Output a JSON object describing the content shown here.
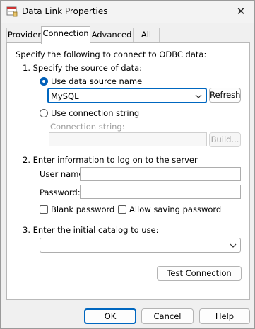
{
  "window": {
    "title": "Data Link Properties",
    "close_glyph": "✕",
    "icon": "datalink-icon"
  },
  "tabs": [
    {
      "label": "Provider"
    },
    {
      "label": "Connection"
    },
    {
      "label": "Advanced"
    },
    {
      "label": "All"
    }
  ],
  "connection": {
    "intro": "Specify the following to connect to ODBC data:",
    "step1": "1. Specify the source of data:",
    "radio_dsn": "Use data source name",
    "dsn_value": "MySQL",
    "refresh": "Refresh",
    "radio_connstr": "Use connection string",
    "connstr_label": "Connection string:",
    "connstr_value": "",
    "build": "Build...",
    "step2": "2. Enter information to log on to the server",
    "username_label": "User name:",
    "username_value": "",
    "password_label": "Password:",
    "password_value": "",
    "blank_password": "Blank password",
    "allow_saving": "Allow saving password",
    "step3": "3. Enter the initial catalog to use:",
    "catalog_value": "",
    "test_connection": "Test Connection"
  },
  "footer": {
    "ok": "OK",
    "cancel": "Cancel",
    "help": "Help"
  },
  "colors": {
    "accent": "#005fb8",
    "focus_border": "#0067c0"
  }
}
